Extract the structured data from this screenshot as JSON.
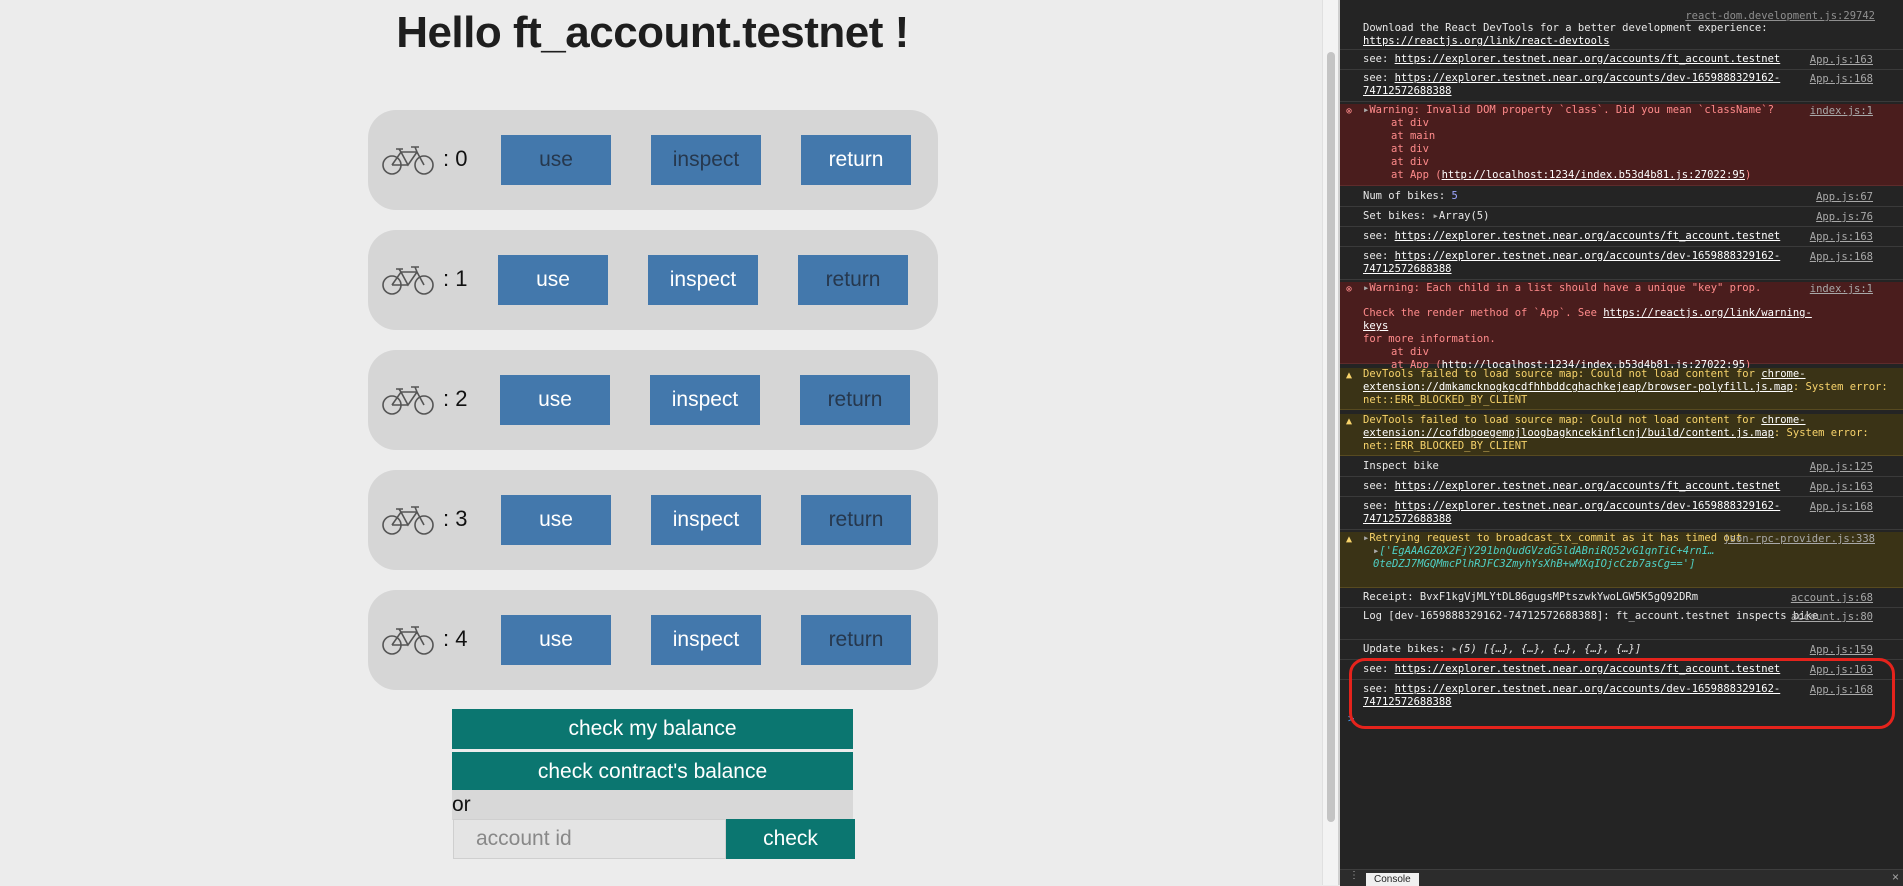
{
  "page": {
    "greeting": "Hello ft_account.testnet !",
    "bikes": [
      {
        "label": ": 0",
        "use": "use",
        "inspect": "inspect",
        "return": "return"
      },
      {
        "label": ": 1",
        "use": "use",
        "inspect": "inspect",
        "return": "return"
      },
      {
        "label": ": 2",
        "use": "use",
        "inspect": "inspect",
        "return": "return"
      },
      {
        "label": ": 3",
        "use": "use",
        "inspect": "inspect",
        "return": "return"
      },
      {
        "label": ": 4",
        "use": "use",
        "inspect": "inspect",
        "return": "return"
      }
    ],
    "check_my_balance": "check my balance",
    "check_contract_balance": "check contract's balance",
    "or_label": "or",
    "account_placeholder": "account id",
    "check_button": "check"
  },
  "console": {
    "top_source": "react-dom.development.js:29742",
    "lines": [
      {
        "kind": "log",
        "text": "Download the React DevTools for a better development experience: ",
        "link": "https://reactjs.org/link/react-devtools",
        "source": ""
      },
      {
        "kind": "log",
        "text": "see: ",
        "link": "https://explorer.testnet.near.org/accounts/ft_account.testnet",
        "source": "App.js:163"
      },
      {
        "kind": "log",
        "text": "see: ",
        "link": "https://explorer.testnet.near.org/accounts/dev-1659888329162-74712572688388",
        "source": "App.js:168"
      },
      {
        "kind": "error",
        "text": "Warning: Invalid DOM property `class`. Did you mean `className`?",
        "extra": [
          "at div",
          "at main",
          "at div",
          "at div"
        ],
        "tail": "at App (",
        "link": "http://localhost:1234/index.b53d4b81.js:27022:95",
        "close": ")",
        "source": "index.js:1"
      },
      {
        "kind": "log",
        "text": "Num of bikes: ",
        "num": "5",
        "source": "App.js:67"
      },
      {
        "kind": "log",
        "text": "Set bikes: ",
        "obj": "Array(5)",
        "source": "App.js:76"
      },
      {
        "kind": "log",
        "text": "see: ",
        "link": "https://explorer.testnet.near.org/accounts/ft_account.testnet",
        "source": "App.js:163"
      },
      {
        "kind": "log",
        "text": "see: ",
        "link": "https://explorer.testnet.near.org/accounts/dev-1659888329162-74712572688388",
        "source": "App.js:168"
      },
      {
        "kind": "error",
        "text": "Warning: Each child in a list should have a unique \"key\" prop.",
        "line2": "Check the render method of `App`. See ",
        "link2": "https://reactjs.org/link/warning-keys",
        "line3": "for more information.",
        "extra": [
          "at div"
        ],
        "tail": "at App (",
        "link": "http://localhost:1234/index.b53d4b81.js:27022:95",
        "close": ")",
        "source": "index.js:1"
      },
      {
        "kind": "warn",
        "text": "DevTools failed to load source map: Could not load content for ",
        "link": "chrome-extension://dmkamcknogkgcdfhhbddcghachkejeap/browser-polyfill.js.map",
        "tail": ": System error: net::ERR_BLOCKED_BY_CLIENT",
        "source": ""
      },
      {
        "kind": "warn",
        "text": "DevTools failed to load source map: Could not load content for ",
        "link": "chrome-extension://cofdbpoegempjloogbagkncekinflcnj/build/content.js.map",
        "tail": ": System error: net::ERR_BLOCKED_BY_CLIENT",
        "source": ""
      },
      {
        "kind": "log",
        "text": "Inspect bike",
        "source": "App.js:125"
      },
      {
        "kind": "log",
        "text": "see: ",
        "link": "https://explorer.testnet.near.org/accounts/ft_account.testnet",
        "source": "App.js:163"
      },
      {
        "kind": "log",
        "text": "see: ",
        "link": "https://explorer.testnet.near.org/accounts/dev-1659888329162-74712572688388",
        "source": "App.js:168"
      },
      {
        "kind": "warn",
        "text": "Retrying request to broadcast_tx_commit as it has timed out",
        "obj": "['EgAAAGZ0X2FjY291bnQudGVzdG5ldABniRQ52vG1qnTiC+4rnI…0teDZJ7MGQMmcPlhRJFC3ZmyhYsXhB+wMXqIOjcCzb7asCg==']",
        "source": "json-rpc-provider.js:338"
      },
      {
        "kind": "log",
        "text": "Receipt: BvxF1kgVjMLYtDL86gugsMPtszwkYwoLGW5K5gQ92DRm",
        "source": "account.js:68"
      },
      {
        "kind": "log",
        "text": "    Log [dev-1659888329162-74712572688388]: ft_account.testnet inspects bike",
        "source": "account.js:80"
      },
      {
        "kind": "log",
        "text": "Update bikes: ",
        "obj": "(5) [{…}, {…}, {…}, {…}, {…}]",
        "source": "App.js:159"
      },
      {
        "kind": "log",
        "text": "see: ",
        "link": "https://explorer.testnet.near.org/accounts/ft_account.testnet",
        "source": "App.js:163"
      },
      {
        "kind": "log",
        "text": "see: ",
        "link": "https://explorer.testnet.near.org/accounts/dev-1659888329162-74712572688388",
        "source": "App.js:168"
      }
    ],
    "prompt": ">",
    "drawer_tab": "Console",
    "drawer_menu": "⋮",
    "drawer_close": "×"
  },
  "colors": {
    "button_blue": "#4378ac",
    "button_teal": "#0b7670",
    "highlight_red": "#e5231c"
  },
  "icons": {
    "bike": "bicycle-icon",
    "error": "error-circle-icon",
    "warning": "warning-triangle-icon"
  }
}
